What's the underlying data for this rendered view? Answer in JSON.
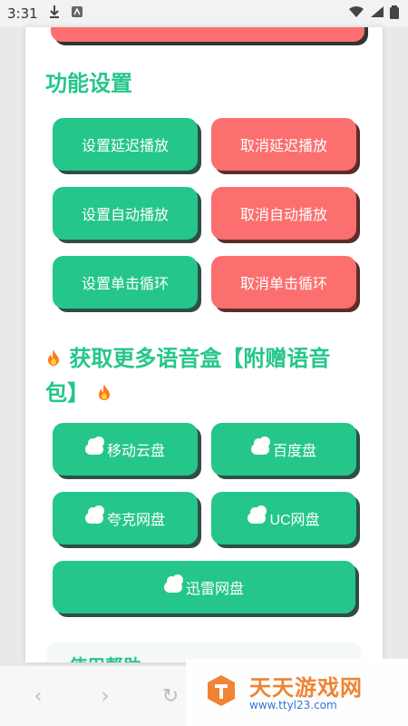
{
  "status_bar": {
    "time": "3:31"
  },
  "section1": {
    "title": "功能设置"
  },
  "buttons1": [
    {
      "label": "设置延迟播放"
    },
    {
      "label": "取消延迟播放"
    },
    {
      "label": "设置自动播放"
    },
    {
      "label": "取消自动播放"
    },
    {
      "label": "设置单击循环"
    },
    {
      "label": "取消单击循环"
    }
  ],
  "section2": {
    "title": "获取更多语音盒【附赠语音包】"
  },
  "cloud_buttons": [
    {
      "label": "移动云盘"
    },
    {
      "label": "百度盘"
    },
    {
      "label": "夸克网盘"
    },
    {
      "label": "UC网盘"
    },
    {
      "label": "迅雷网盘"
    }
  ],
  "help": {
    "title": "使用帮助"
  },
  "watermark": {
    "text": "天天游戏网",
    "url": "www.ttyl23.com"
  },
  "colors": {
    "green": "#25c68a",
    "red": "#fb6f6f",
    "orange": "#f07f2d"
  }
}
